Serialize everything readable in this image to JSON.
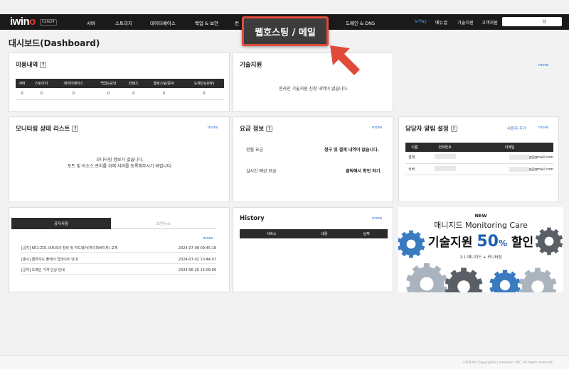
{
  "header": {
    "logo_main": "iwin",
    "logo_accent": "o",
    "logo_badge": "Cafe24",
    "menu": [
      {
        "label": "서버"
      },
      {
        "label": "스토리지"
      },
      {
        "label": "데이터베이스"
      },
      {
        "label": "백업 & 보안"
      },
      {
        "label": "컨"
      },
      {
        "label": "도메인 & DNS"
      }
    ],
    "right": [
      {
        "label": "V-Pay"
      },
      {
        "label": "매뉴얼"
      },
      {
        "label": "기술지원"
      },
      {
        "label": "고객지원"
      }
    ],
    "user_suffix": "님",
    "highlight_label": "웹호스팅 / 메일"
  },
  "page_title": "대시보드(Dashboard)",
  "usage": {
    "title": "이용내역",
    "help": "?",
    "columns": [
      "서버",
      "스토리지",
      "데이터베이스",
      "백업&보안",
      "컨텐츠",
      "웹호스팅/문자",
      "도메인&DNS"
    ],
    "values": [
      "0",
      "0",
      "0",
      "0",
      "0",
      "0",
      "0"
    ]
  },
  "tech": {
    "title": "기술지원",
    "more": "more",
    "empty": "온라인 기술지원 신청 내역이 없습니다."
  },
  "monitor": {
    "title": "모니터링 상태 리스트",
    "help": "?",
    "more": "more",
    "msg1": "모니터링 정보가 없습니다.",
    "msg2": "포트 및 리소스 관리를 위해 서버를 등록해주시기 바랍니다."
  },
  "fee": {
    "title": "요금 정보",
    "help": "?",
    "more": "more",
    "row1_label": "전월 요금",
    "row1_value": "청구 및 결제 내역이 없습니다.",
    "row2_label": "실시간 예상 요금",
    "row2_value": "클릭해서 확인 하기"
  },
  "contact": {
    "title": "담당자 알림 설정",
    "help": "?",
    "add_user": "사용자 추가",
    "more": "more",
    "columns": [
      "이름",
      "전화번호",
      "이메일"
    ],
    "rows": [
      {
        "name": "결제",
        "email": "g@gmail.com"
      },
      {
        "name": "서버",
        "email": "g@gmail.com"
      }
    ]
  },
  "notice": {
    "tab_active": "공지사항",
    "tab_inactive": "보안뉴스",
    "more": "more",
    "items": [
      {
        "title": "[공지] KR1-Z01 네트워크 장비 및 하드웨어(하이퍼바이저) 교체",
        "date": "2024-07-08 09:45:18"
      },
      {
        "title": "[출시] 클라우드 플레이 업데이트 안내",
        "date": "2024-07-02 10:44:07"
      },
      {
        "title": "[공지] 도메인 가격 인상 안내",
        "date": "2024-06-20 15:09:09"
      }
    ]
  },
  "history": {
    "title": "History",
    "more": "more",
    "columns": [
      "서비스",
      "내용",
      "날짜"
    ]
  },
  "banner": {
    "new": "NEW",
    "care": "매니지드 Monitoring Care",
    "big_prefix": "기술지원 ",
    "big_pct": "50",
    "big_pct_sign": "%",
    "big_suffix": " 할인",
    "small": "1:1 매니지드 + 모니터링",
    "gear_color_dark": "#5a5f66",
    "gear_color_blue": "#3a7bbf",
    "gear_color_light": "#a9b4bf"
  },
  "footer": {
    "copyright": "스마일서브 Copyright(c) smileserv INC. All rights reserved."
  }
}
